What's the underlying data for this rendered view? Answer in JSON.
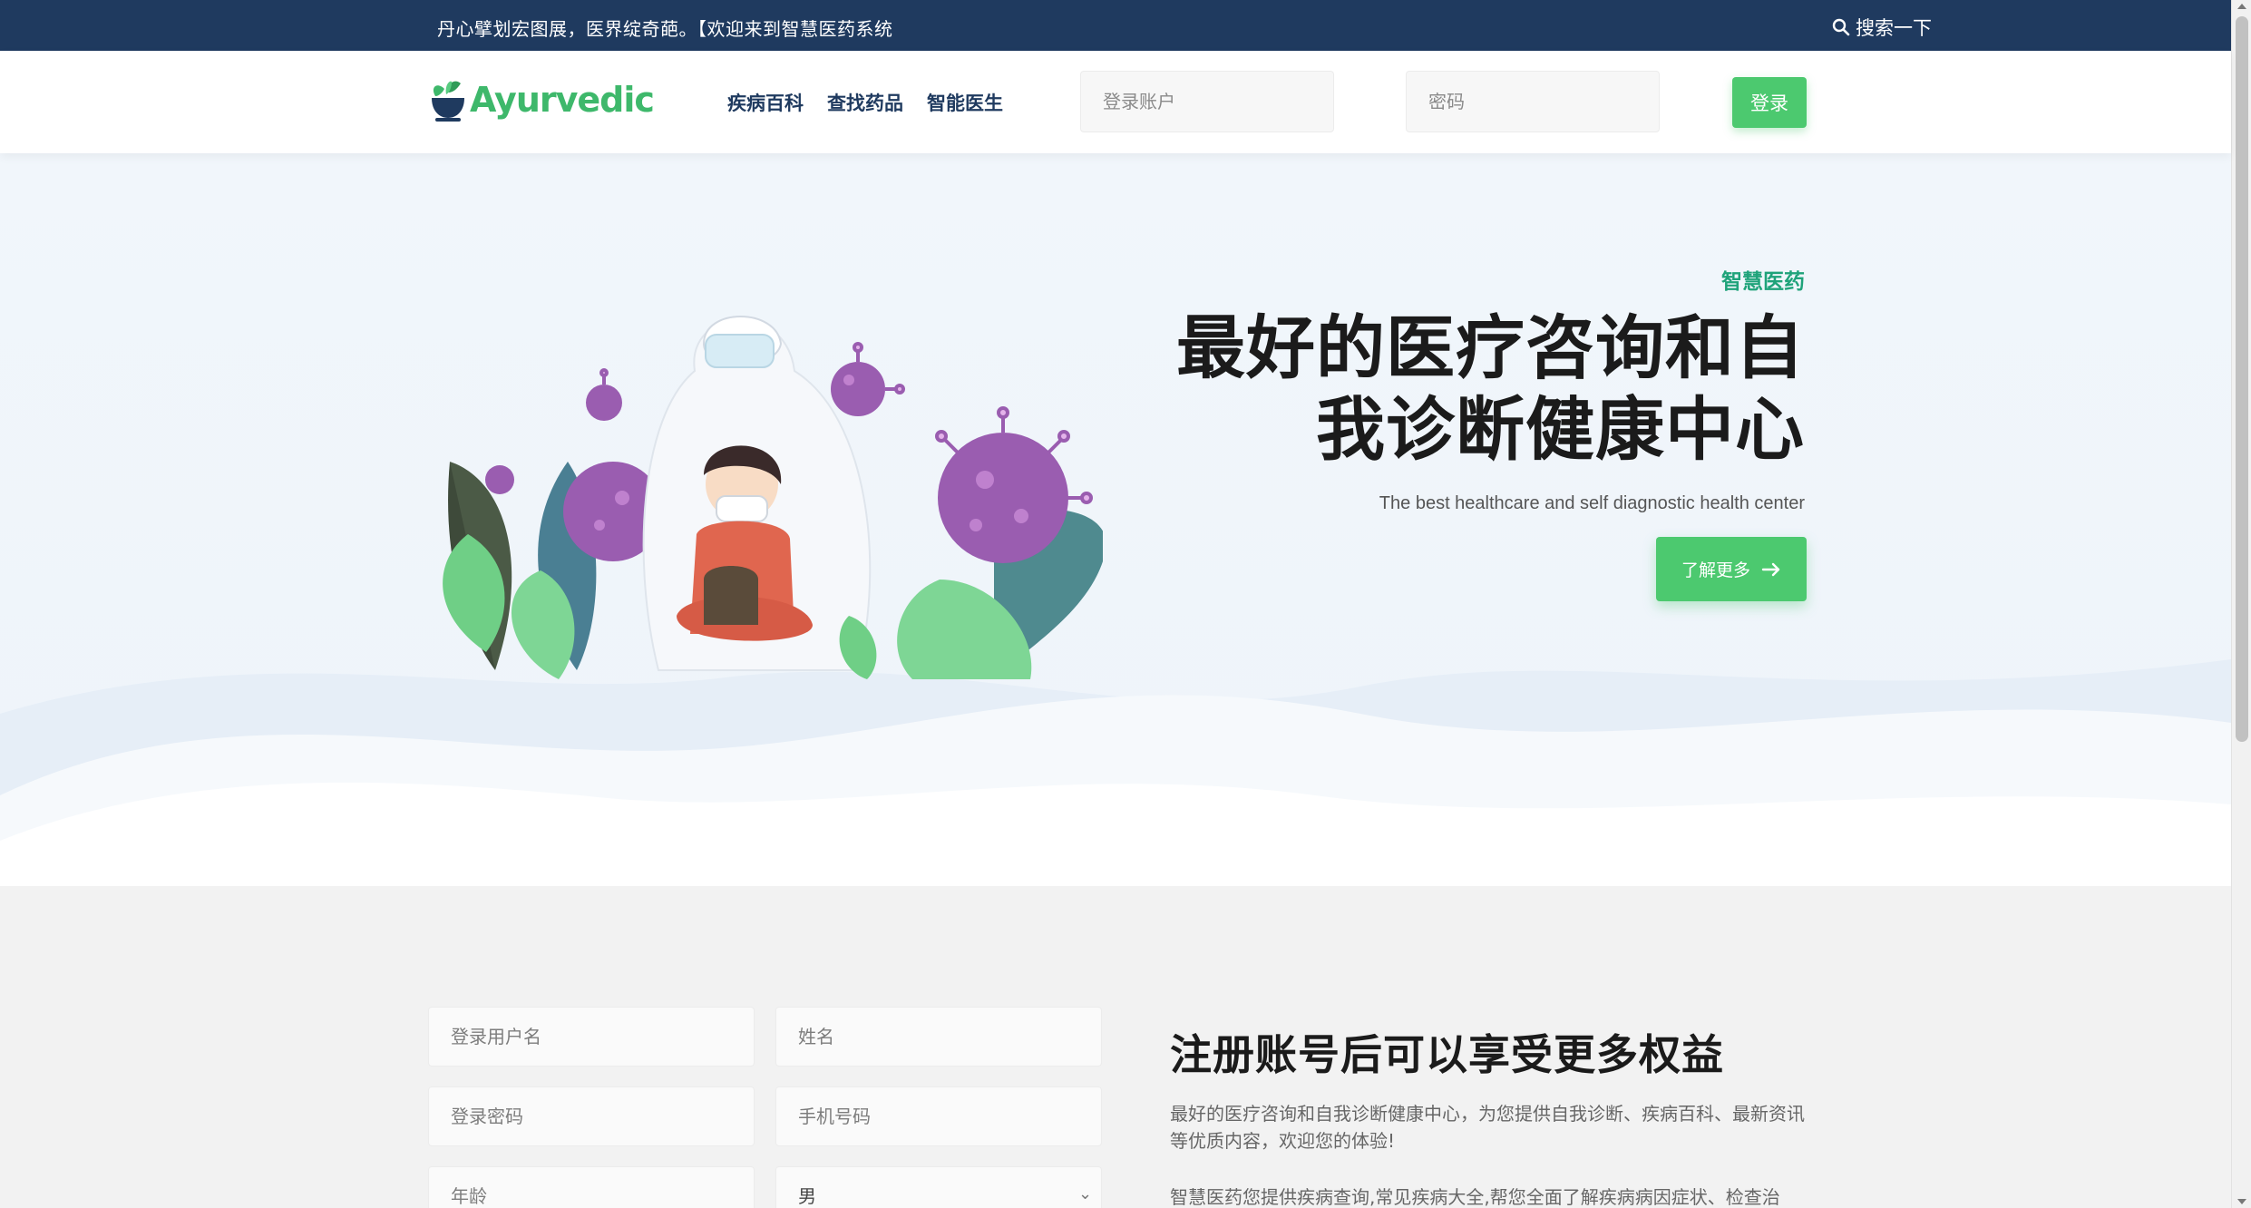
{
  "topbar": {
    "announcement": "丹心擘划宏图展，医界绽奇葩。【欢迎来到智慧医药系统",
    "search_label": "搜索一下"
  },
  "header": {
    "logo_text": "Ayurvedic",
    "nav": [
      {
        "label": "疾病百科"
      },
      {
        "label": "查找药品"
      },
      {
        "label": "智能医生"
      }
    ],
    "username_placeholder": "登录账户",
    "password_placeholder": "密码",
    "login_label": "登录"
  },
  "hero": {
    "kicker": "智慧医药",
    "title_line1": "最好的医疗咨询和自",
    "title_line2": "我诊断健康中心",
    "subtitle": "The best healthcare and self diagnostic health center",
    "cta_label": "了解更多"
  },
  "register": {
    "username_placeholder": "登录用户名",
    "name_placeholder": "姓名",
    "password_placeholder": "登录密码",
    "phone_placeholder": "手机号码",
    "age_placeholder": "年龄",
    "gender_options": [
      "男"
    ],
    "title": "注册账号后可以享受更多权益",
    "description": "最好的医疗咨询和自我诊断健康中心，为您提供自我诊断、疾病百科、最新资讯等优质内容，欢迎您的体验!",
    "description2": "智慧医药您提供疾病查询,常见疾病大全,帮您全面了解疾病病因症状、检查治"
  },
  "colors": {
    "topbar": "#1f3a5f",
    "accent_green": "#4cc96f",
    "kicker_green": "#1fa37a",
    "nav_text": "#1f3a5f"
  }
}
